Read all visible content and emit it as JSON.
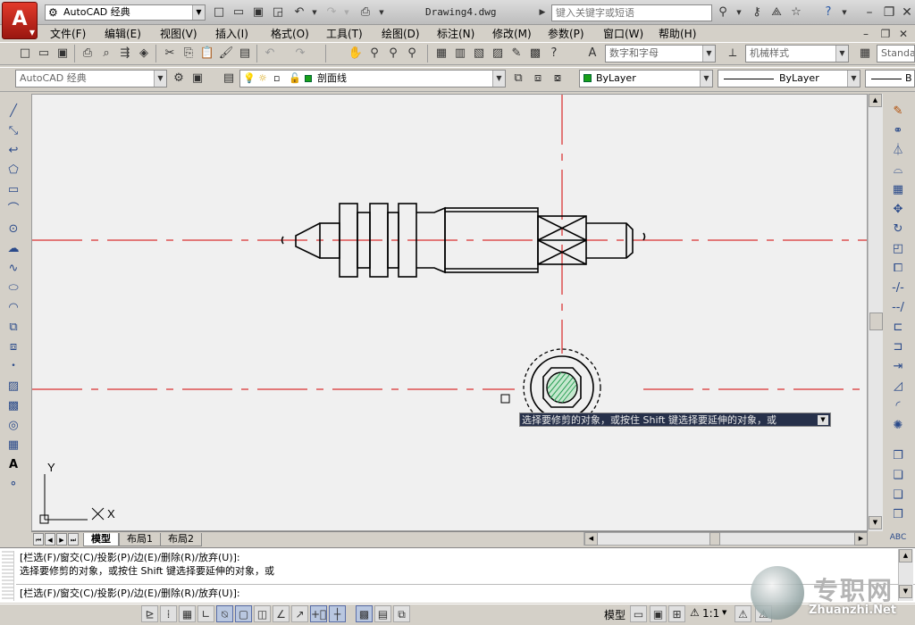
{
  "app": {
    "logo_letter": "A",
    "workspace": "AutoCAD 经典",
    "document_title": "Drawing4.dwg",
    "search_placeholder": "键入关键字或短语"
  },
  "menu": [
    "文件(F)",
    "编辑(E)",
    "视图(V)",
    "插入(I)",
    "格式(O)",
    "工具(T)",
    "绘图(D)",
    "标注(N)",
    "修改(M)",
    "参数(P)",
    "窗口(W)",
    "帮助(H)"
  ],
  "styles": {
    "text_style": "数字和字母",
    "dim_style": "机械样式",
    "table_style": "Standa"
  },
  "layers": {
    "workspace_combo": "AutoCAD 经典",
    "current_layer": "剖面线",
    "color": "ByLayer",
    "linetype": "ByLayer",
    "lineweight_prefix": "B"
  },
  "tabs": [
    "模型",
    "布局1",
    "布局2"
  ],
  "command_lines": [
    "[栏选(F)/窗交(C)/投影(P)/边(E)/删除(R)/放弃(U)]:",
    "选择要修剪的对象，或按住 Shift 键选择要延伸的对象，或",
    "[栏选(F)/窗交(C)/投影(P)/边(E)/删除(R)/放弃(U)]:"
  ],
  "tooltip": "选择要修剪的对象，或按住 Shift 键选择要延伸的对象，或",
  "status": {
    "model_label": "模型",
    "scale": "1:1"
  },
  "ucs": {
    "x": "X",
    "y": "Y"
  },
  "watermark": {
    "title": "专职网",
    "url": "Zhuanzhi.Net"
  },
  "colors": {
    "centerline": "#d40000",
    "hatch": "#2aa055",
    "title_accent": "#c2261a"
  }
}
